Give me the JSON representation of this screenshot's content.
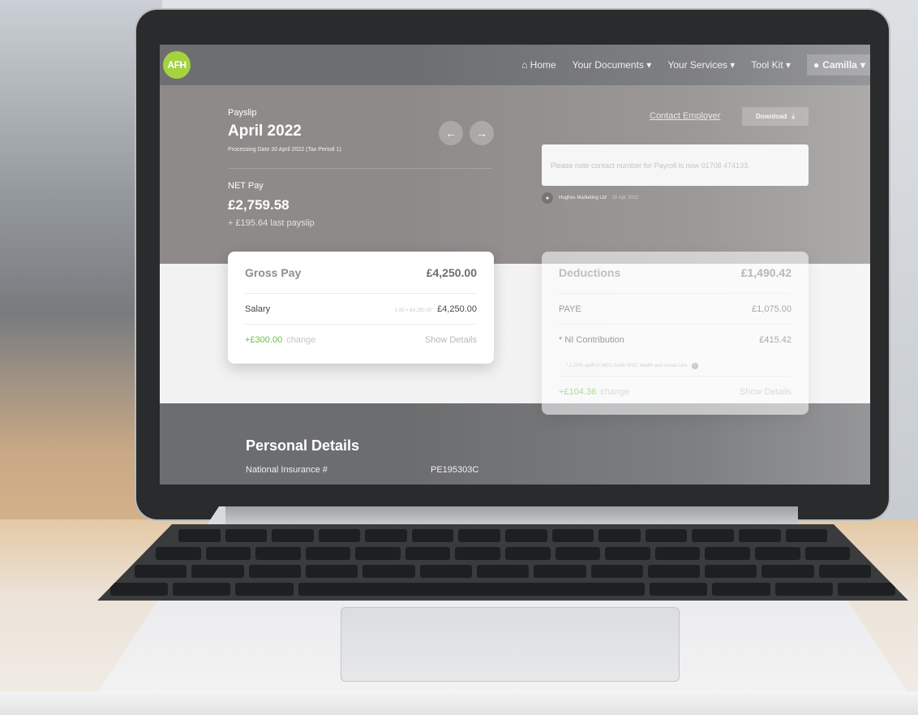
{
  "nav": {
    "logo": "AFH",
    "home": "Home",
    "documents": "Your Documents",
    "services": "Your Services",
    "toolkit": "Tool Kit",
    "user": "Camilla"
  },
  "payslip": {
    "label": "Payslip",
    "period": "April 2022",
    "processing": "Processing Date 30 April 2022 (Tax Period 1)",
    "net_label": "NET Pay",
    "net_amount": "£2,759.58",
    "net_diff": "+ £195.64 last payslip"
  },
  "actions": {
    "contact": "Contact Employer",
    "download": "Download"
  },
  "notice": {
    "text": "Please note contact number for Payroll is now 01708 474133.",
    "sender": "Hughes Marketing Ltd",
    "date": "30 Apr 2022"
  },
  "gross": {
    "title": "Gross Pay",
    "total": "£4,250.00",
    "rows": [
      {
        "label": "Salary",
        "qty": "1.00 × £4,250.00",
        "value": "£4,250.00"
      }
    ],
    "change": "+£300.00",
    "change_word": "change",
    "show_details": "Show Details"
  },
  "deductions": {
    "title": "Deductions",
    "total": "£1,490.42",
    "rows": [
      {
        "label": "PAYE",
        "value": "£1,075.00"
      },
      {
        "label": "* NI Contribution",
        "value": "£415.42"
      }
    ],
    "note": "* 1.25% uplift in NICs funds NHS, health and social care.",
    "change": "+£104.36",
    "change_word": "change",
    "show_details": "Show Details"
  },
  "personal": {
    "title": "Personal Details",
    "ni_label": "National Insurance #",
    "ni_value": "PE195303C"
  },
  "colors": {
    "brand": "#a4d33f",
    "positive": "#6cbf3f",
    "header": "#6d6e70"
  }
}
